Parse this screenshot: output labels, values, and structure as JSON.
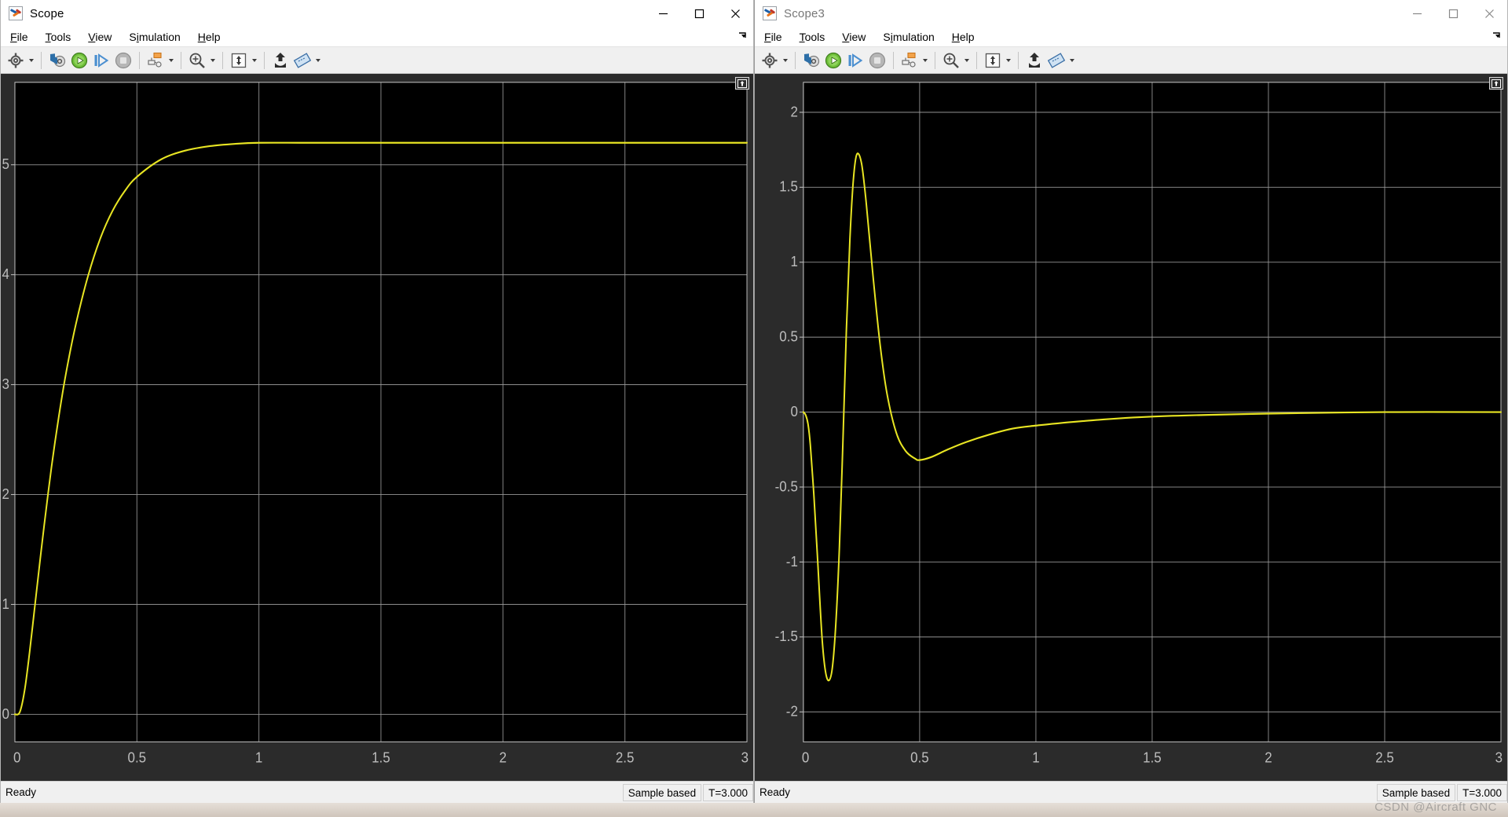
{
  "windows": [
    {
      "id": "scope1",
      "title": "Scope",
      "active": true,
      "menus": [
        {
          "label": "File",
          "mnemonic": "F"
        },
        {
          "label": "Tools",
          "mnemonic": "T"
        },
        {
          "label": "View",
          "mnemonic": "V"
        },
        {
          "label": "Simulation",
          "mnemonic": "i"
        },
        {
          "label": "Help",
          "mnemonic": "H"
        }
      ],
      "window_controls": [
        "minimize",
        "maximize",
        "close"
      ],
      "toolbar": [
        {
          "name": "configuration-properties-icon",
          "label": "Configuration Properties",
          "caret": true
        },
        {
          "name": "step-back-icon",
          "label": "Step Back",
          "caret": false
        },
        {
          "name": "run-icon",
          "label": "Run",
          "caret": false
        },
        {
          "name": "step-forward-icon",
          "label": "Step Forward",
          "caret": false
        },
        {
          "name": "stop-icon",
          "label": "Stop",
          "caret": false
        },
        {
          "name": "signal-selection-icon",
          "label": "Signal Selection",
          "caret": true
        },
        {
          "name": "zoom-in-icon",
          "label": "Zoom In",
          "caret": true
        },
        {
          "name": "autoscale-icon",
          "label": "Scale Axes Limits",
          "caret": true
        },
        {
          "name": "lock-axes-icon",
          "label": "Lock Axes Scaling",
          "caret": false
        },
        {
          "name": "cursor-measurements-icon",
          "label": "Cursor Measurements",
          "caret": true
        }
      ],
      "status": {
        "message": "Ready",
        "sample_mode": "Sample based",
        "time": "T=3.000"
      }
    },
    {
      "id": "scope3",
      "title": "Scope3",
      "active": false,
      "menus": [
        {
          "label": "File",
          "mnemonic": "F"
        },
        {
          "label": "Tools",
          "mnemonic": "T"
        },
        {
          "label": "View",
          "mnemonic": "V"
        },
        {
          "label": "Simulation",
          "mnemonic": "i"
        },
        {
          "label": "Help",
          "mnemonic": "H"
        }
      ],
      "window_controls": [
        "minimize",
        "maximize",
        "close"
      ],
      "toolbar": [
        {
          "name": "configuration-properties-icon",
          "label": "Configuration Properties",
          "caret": true
        },
        {
          "name": "step-back-icon",
          "label": "Step Back",
          "caret": false
        },
        {
          "name": "run-icon",
          "label": "Run",
          "caret": false
        },
        {
          "name": "step-forward-icon",
          "label": "Step Forward",
          "caret": false
        },
        {
          "name": "stop-icon",
          "label": "Stop",
          "caret": false
        },
        {
          "name": "signal-selection-icon",
          "label": "Signal Selection",
          "caret": true
        },
        {
          "name": "zoom-in-icon",
          "label": "Zoom In",
          "caret": true
        },
        {
          "name": "autoscale-icon",
          "label": "Scale Axes Limits",
          "caret": true
        },
        {
          "name": "lock-axes-icon",
          "label": "Lock Axes Scaling",
          "caret": false
        },
        {
          "name": "cursor-measurements-icon",
          "label": "Cursor Measurements",
          "caret": true
        }
      ],
      "status": {
        "message": "Ready",
        "sample_mode": "Sample based",
        "time": "T=3.000"
      }
    }
  ],
  "watermark": "CSDN @Aircraft GNC",
  "colors": {
    "trace": "#e8e523",
    "plot_background": "#000000",
    "plot_margin": "#2b2b2b",
    "grid": "#9a9a9a",
    "tick_label": "#bdbdbd",
    "toolbar_background": "#f0f0f0",
    "title_background": "#ffffff"
  },
  "chart_data": [
    {
      "type": "line",
      "title": "Scope",
      "xlabel": "",
      "ylabel": "",
      "xlim": [
        0,
        3
      ],
      "ylim": [
        -0.25,
        5.75
      ],
      "xticks": [
        "0",
        "0.5",
        "1",
        "1.5",
        "2",
        "2.5",
        "3"
      ],
      "xtick_values": [
        0,
        0.5,
        1,
        1.5,
        2,
        2.5,
        3
      ],
      "yticks": [
        "0",
        "1",
        "2",
        "3",
        "4",
        "5"
      ],
      "ytick_values": [
        0,
        1,
        2,
        3,
        4,
        5
      ],
      "grid": true,
      "legend": "none",
      "series": [
        {
          "name": "signal",
          "color": "#e8e523",
          "description": "First-order step response rising from 0 to steady state 5.2",
          "x": [
            0,
            0.02,
            0.04,
            0.06,
            0.08,
            0.1,
            0.12,
            0.15,
            0.18,
            0.21,
            0.25,
            0.3,
            0.35,
            0.4,
            0.45,
            0.5,
            0.6,
            0.7,
            0.8,
            0.9,
            1.0,
            1.2,
            1.5,
            2.0,
            2.5,
            3.0
          ],
          "y": [
            0.0,
            0.02,
            0.22,
            0.56,
            0.95,
            1.34,
            1.72,
            2.25,
            2.71,
            3.11,
            3.55,
            3.99,
            4.33,
            4.58,
            4.76,
            4.89,
            5.05,
            5.13,
            5.17,
            5.19,
            5.2,
            5.2,
            5.2,
            5.2,
            5.2,
            5.2
          ]
        }
      ]
    },
    {
      "type": "line",
      "title": "Scope3",
      "xlabel": "",
      "ylabel": "",
      "xlim": [
        0,
        3
      ],
      "ylim": [
        -2.2,
        2.2
      ],
      "xticks": [
        "0",
        "0.5",
        "1",
        "1.5",
        "2",
        "2.5",
        "3"
      ],
      "xtick_values": [
        0,
        0.5,
        1,
        1.5,
        2,
        2.5,
        3
      ],
      "yticks": [
        "2",
        "1.5",
        "1",
        "0.5",
        "0",
        "-0.5",
        "-1",
        "-1.5",
        "-2"
      ],
      "ytick_values": [
        2,
        1.5,
        1,
        0.5,
        0,
        -0.5,
        -1,
        -1.5,
        -2
      ],
      "grid": true,
      "legend": "none",
      "series": [
        {
          "name": "signal",
          "color": "#e8e523",
          "description": "Control effort: dips to -1.79 at t=0.11, overshoots to 1.72 at t=0.23, undershoots to -0.32 at t=0.50, settles to 0",
          "x": [
            0,
            0.01,
            0.02,
            0.03,
            0.045,
            0.06,
            0.08,
            0.095,
            0.11,
            0.125,
            0.14,
            0.155,
            0.17,
            0.185,
            0.2,
            0.215,
            0.23,
            0.25,
            0.27,
            0.3,
            0.33,
            0.36,
            0.4,
            0.44,
            0.48,
            0.5,
            0.55,
            0.62,
            0.7,
            0.8,
            0.9,
            1.0,
            1.2,
            1.5,
            2.0,
            2.5,
            3.0
          ],
          "y": [
            0.0,
            -0.02,
            -0.08,
            -0.22,
            -0.55,
            -0.95,
            -1.5,
            -1.73,
            -1.79,
            -1.7,
            -1.4,
            -0.9,
            -0.2,
            0.55,
            1.15,
            1.55,
            1.72,
            1.66,
            1.4,
            0.9,
            0.45,
            0.12,
            -0.14,
            -0.26,
            -0.31,
            -0.32,
            -0.3,
            -0.25,
            -0.2,
            -0.15,
            -0.11,
            -0.09,
            -0.06,
            -0.03,
            -0.01,
            0.0,
            0.0
          ]
        }
      ]
    }
  ]
}
